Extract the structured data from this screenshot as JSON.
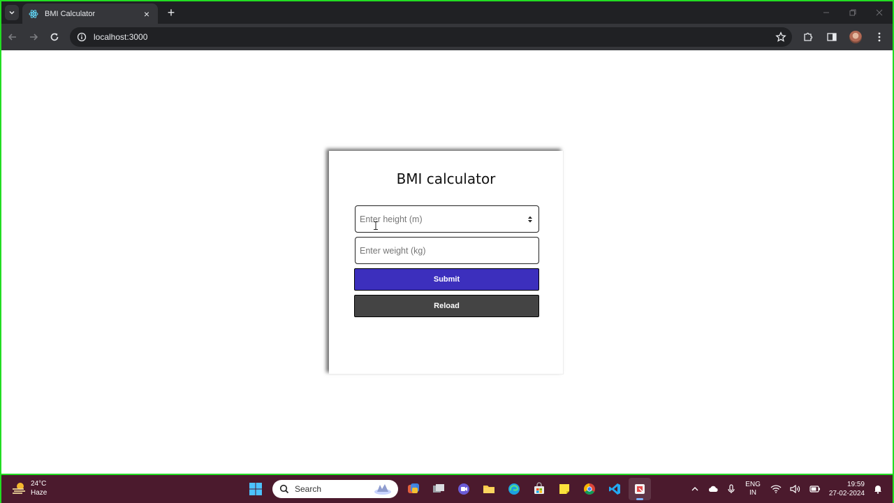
{
  "browser": {
    "tab_title": "BMI Calculator",
    "address": "localhost:3000",
    "tab_close_icon": "×",
    "new_tab_icon": "+"
  },
  "app": {
    "title": "BMI calculator",
    "height_placeholder": "Enter height (m)",
    "weight_placeholder": "Enter weight (kg)",
    "submit_label": "Submit",
    "reload_label": "Reload",
    "accent_color": "#3c2fbd",
    "reload_color": "#444444"
  },
  "taskbar": {
    "weather_temp": "24°C",
    "weather_desc": "Haze",
    "search_label": "Search",
    "lang_top": "ENG",
    "lang_bottom": "IN",
    "time": "19:59",
    "date": "27-02-2024",
    "background_color": "#4b1a2d"
  }
}
